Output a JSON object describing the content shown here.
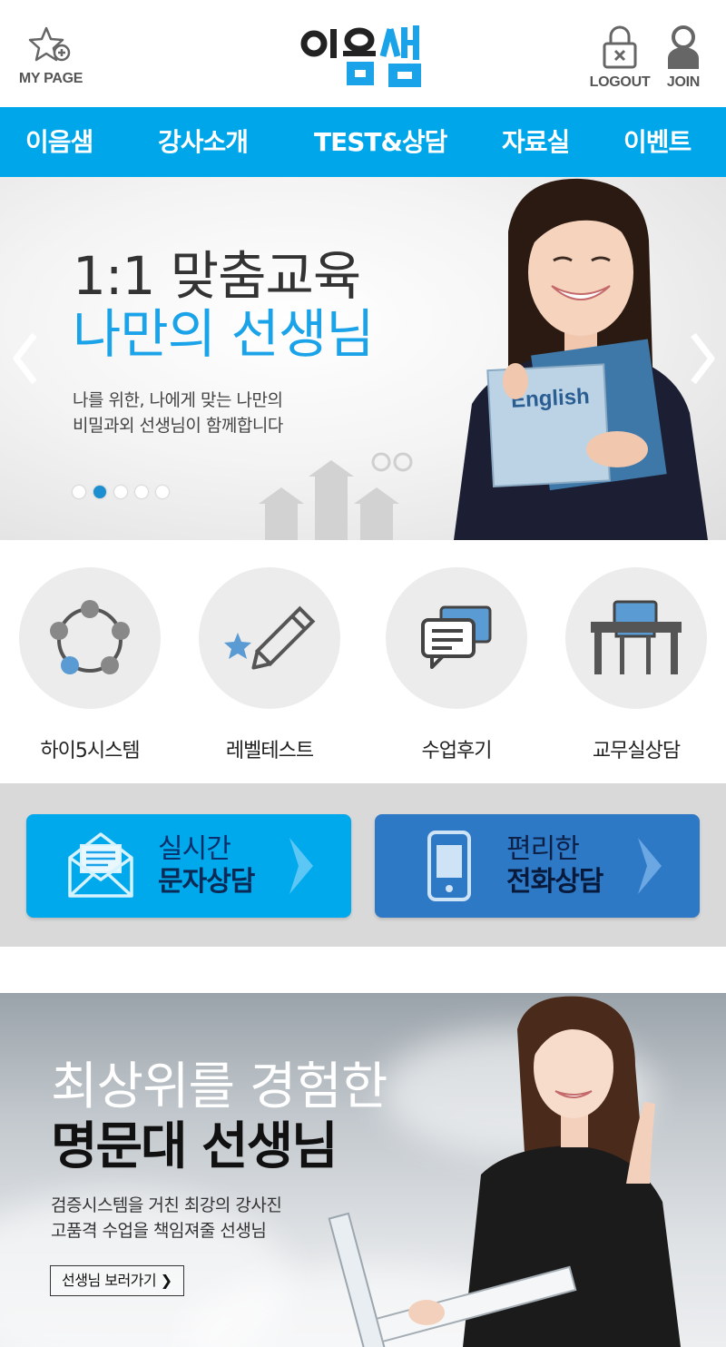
{
  "header": {
    "mypage_label": "MY PAGE",
    "logout_label": "LOGOUT",
    "join_label": "JOIN",
    "logo_text": "이음샘"
  },
  "nav": {
    "items": [
      "이음샘",
      "강사소개",
      "TEST&상담",
      "자료실",
      "이벤트"
    ]
  },
  "hero": {
    "title_line1": "1:1 맞춤교육",
    "title_line2": "나만의 선생님",
    "sub_line1": "나를 위한, 나에게 맞는 나만의",
    "sub_line2": "비밀과외 선생님이 함께합니다",
    "book_text": "English",
    "slide_count": 5,
    "active_slide": 2
  },
  "quick": {
    "items": [
      "하이5시스템",
      "레벨테스트",
      "수업후기",
      "교무실상담"
    ]
  },
  "consult": {
    "sms_line1": "실시간",
    "sms_line2": "문자상담",
    "tel_line1": "편리한",
    "tel_line2": "전화상담"
  },
  "teachers": {
    "title_line1": "최상위를 경험한",
    "title_line2": "명문대 선생님",
    "sub_line1": "검증시스템을 거친 최강의 강사진",
    "sub_line2": "고품격 수업을 책임져줄 선생님",
    "button_label": "선생님 보러가기 ❯"
  },
  "colors": {
    "brand_blue": "#00a6ea",
    "dark_blue": "#2e79c6",
    "accent_text": "#1aa3e8"
  }
}
